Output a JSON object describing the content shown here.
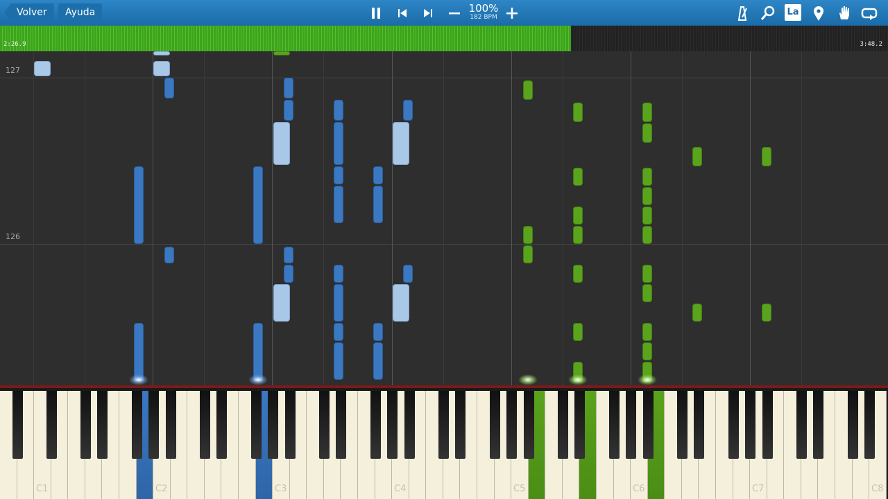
{
  "toolbar": {
    "back_label": "Volver",
    "help_label": "Ayuda",
    "tempo_percent": "100%",
    "tempo_bpm": "182 BPM",
    "language_badge": "La",
    "icons": [
      "pause-icon",
      "skip-back-icon",
      "skip-forward-icon",
      "minus-icon",
      "plus-icon",
      "metronome-icon",
      "search-icon",
      "location-pin-icon",
      "hand-icon",
      "loop-icon"
    ]
  },
  "progress": {
    "current_time": "2:26.9",
    "total_time": "3:48.2",
    "fraction": 0.643,
    "color": "#52c22c"
  },
  "roll": {
    "measures": [
      "127",
      "126"
    ]
  },
  "keyboard": {
    "octave_labels": [
      "C1",
      "C2",
      "C3",
      "C4",
      "C5",
      "C6",
      "C7",
      "C8"
    ]
  },
  "colors": {
    "left_hand": "#3a78c2",
    "left_hand_light": "#a9c7e6",
    "right_hand": "#5aa31c"
  }
}
